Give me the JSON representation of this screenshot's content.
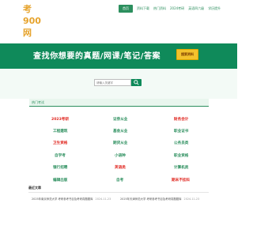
{
  "header": {
    "logo_text": "考900网",
    "nav": [
      {
        "label": "首页"
      },
      {
        "label": "资料下载"
      },
      {
        "label": "热门资料"
      },
      {
        "label": "2024考研"
      },
      {
        "label": "英语四六级"
      },
      {
        "label": "学历提升"
      }
    ]
  },
  "banner": {
    "title": "查找你想要的真题/网课/笔记/答案",
    "button_label": "搜索资料"
  },
  "search": {
    "placeholder": "请输入关键字"
  },
  "hot": {
    "label": "热门考试",
    "columns": [
      [
        {
          "label": "2023考研",
          "red": true
        },
        {
          "label": "工程建筑",
          "red": false
        },
        {
          "label": "卫生资格",
          "red": true
        },
        {
          "label": "自学考",
          "red": false
        },
        {
          "label": "银行招聘",
          "red": false
        },
        {
          "label": "编辑出版",
          "red": false
        }
      ],
      [
        {
          "label": "证券从业",
          "red": false
        },
        {
          "label": "基金从业",
          "red": false
        },
        {
          "label": "期货从业",
          "red": false
        },
        {
          "label": "小语种",
          "red": false
        },
        {
          "label": "英语类",
          "red": true
        },
        {
          "label": "自考",
          "red": false
        }
      ],
      [
        {
          "label": "财务会计",
          "red": true
        },
        {
          "label": "职业证书",
          "red": false
        },
        {
          "label": "公务员类",
          "red": false
        },
        {
          "label": "职业资格",
          "red": false
        },
        {
          "label": "计算机类",
          "red": false
        },
        {
          "label": "期末不挂科",
          "red": true
        }
      ]
    ]
  },
  "recent": {
    "label": "最近文章",
    "items": [
      {
        "title": "2025年南京师范大学 考研参考书目及考研真题题库",
        "date": "2024-11-23"
      },
      {
        "title": "2025年天津师范大学 考研参考书目及考研真题题库",
        "date": "2024-11-23"
      }
    ]
  },
  "colors": {
    "brand_green": "#0f8a5a",
    "accent_yellow": "#f3c22d",
    "highlight_red": "#e0261f",
    "logo_orange": "#e6a32c"
  }
}
